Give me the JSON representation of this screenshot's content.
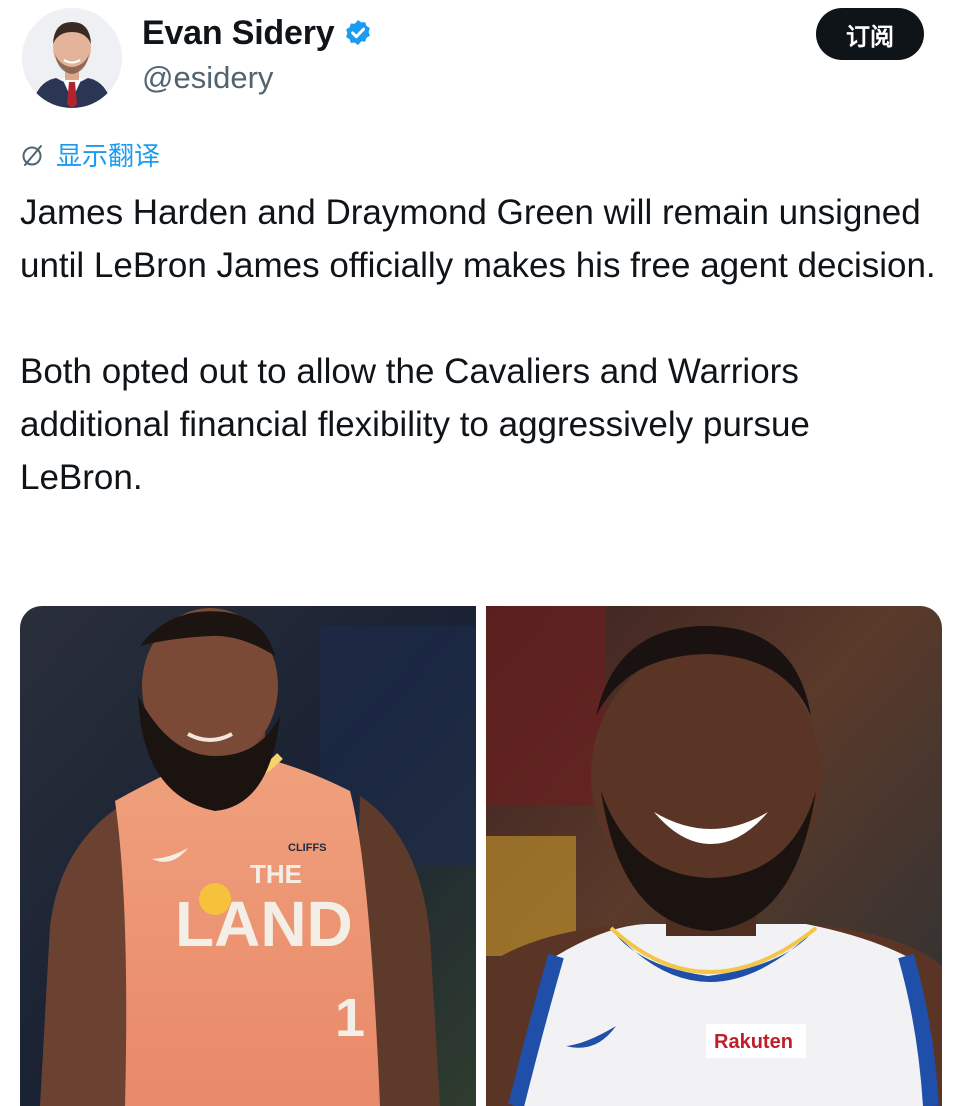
{
  "author": {
    "display_name": "Evan Sidery",
    "handle": "@esidery",
    "verified": true
  },
  "actions": {
    "subscribe_label": "订阅"
  },
  "translate": {
    "label": "显示翻译"
  },
  "tweet": {
    "paragraph_1": "James Harden and Draymond Green will remain unsigned until LeBron James officially makes his free agent decision.",
    "paragraph_2": "Both opted out to allow the Cavaliers and Warriors additional financial flexibility to aggressively pursue LeBron."
  },
  "media": {
    "left": {
      "subject": "player-photo",
      "jersey_logo": "CLIFFS",
      "jersey_text_small": "THE",
      "jersey_text": "LAND",
      "jersey_number": "1"
    },
    "right": {
      "subject": "player-photo",
      "sponsor_patch": "Rakuten"
    }
  },
  "colors": {
    "accent": "#1d9bf0",
    "text_primary": "#0f1419",
    "text_secondary": "#536471",
    "button_bg": "#0f1419"
  },
  "icons": {
    "verified": "verified-badge-icon",
    "translate": "translate-icon"
  }
}
